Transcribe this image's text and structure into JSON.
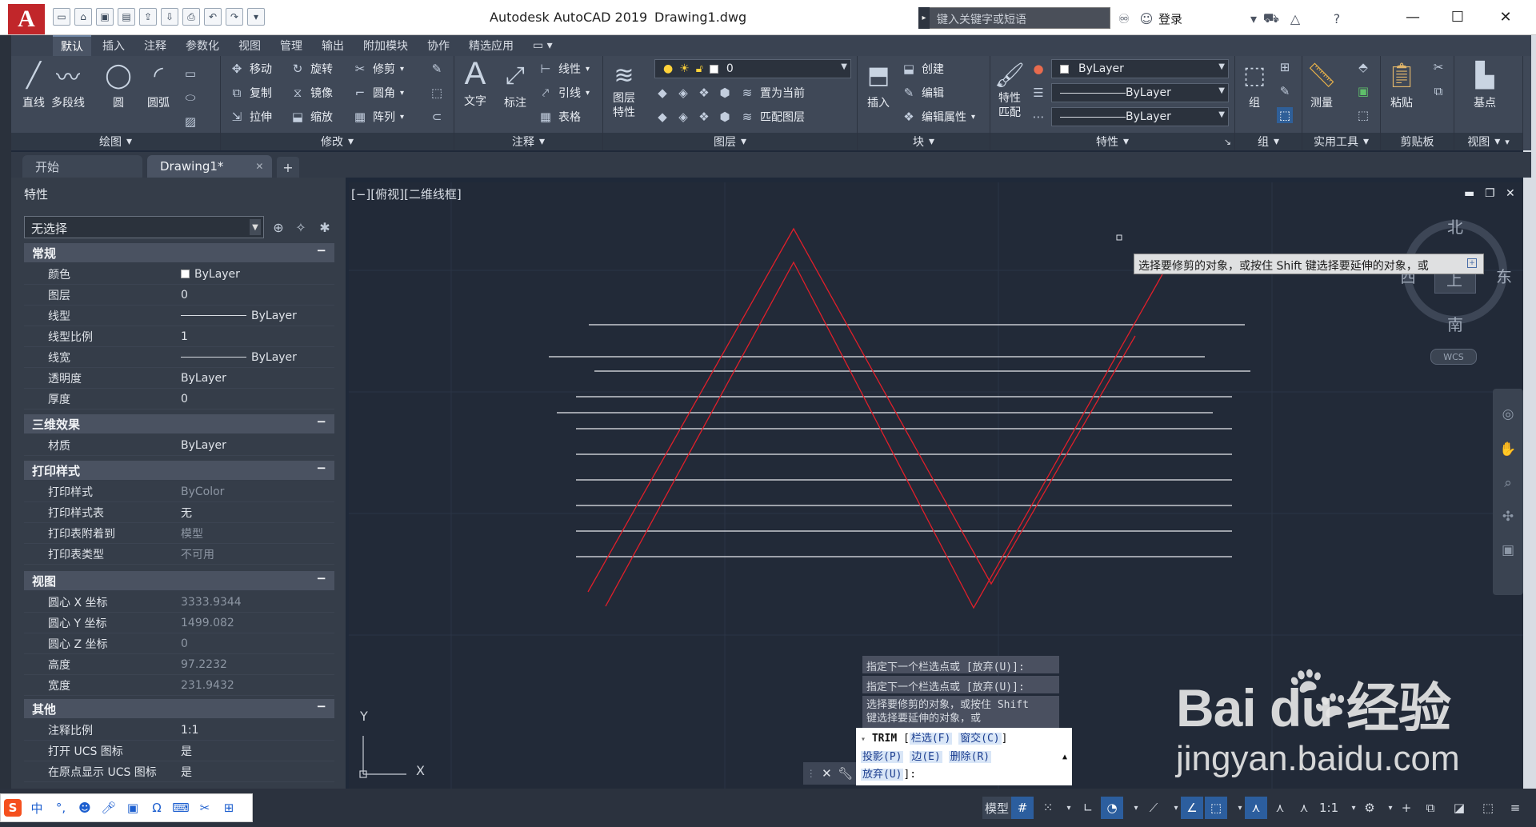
{
  "titlebar": {
    "app_title": "Autodesk AutoCAD 2019",
    "doc_title": "Drawing1.dwg",
    "search_placeholder": "键入关键字或短语",
    "signin_label": "登录",
    "logo_letter": "A"
  },
  "ribbon_tabs": [
    "默认",
    "插入",
    "注释",
    "参数化",
    "视图",
    "管理",
    "输出",
    "附加模块",
    "协作",
    "精选应用"
  ],
  "panels": {
    "draw": {
      "title": "绘图",
      "line": "直线",
      "polyline": "多段线",
      "circle": "圆",
      "arc": "圆弧"
    },
    "modify": {
      "title": "修改",
      "move": "移动",
      "rotate": "旋转",
      "trim": "修剪",
      "copy": "复制",
      "mirror": "镜像",
      "fillet": "圆角",
      "stretch": "拉伸",
      "scale": "缩放",
      "array": "阵列"
    },
    "annotation": {
      "title": "注释",
      "text": "文字",
      "dimension": "标注",
      "linear": "线性",
      "leader": "引线",
      "table": "表格"
    },
    "layers": {
      "title": "图层",
      "layer_props_1": "图层",
      "layer_props_2": "特性",
      "layer_value": "0",
      "set_current": "置为当前",
      "match_layer": "匹配图层"
    },
    "block": {
      "title": "块",
      "insert": "插入",
      "create": "创建",
      "edit": "编辑",
      "edit_attr": "编辑属性"
    },
    "properties": {
      "title": "特性",
      "match_1": "特性",
      "match_2": "匹配",
      "color": "ByLayer",
      "linetype": "ByLayer",
      "lineweight": "ByLayer"
    },
    "groups": {
      "title": "组",
      "group": "组"
    },
    "utilities": {
      "title": "实用工具",
      "measure": "测量"
    },
    "clipboard": {
      "title": "剪贴板",
      "paste": "粘贴"
    },
    "view": {
      "title": "视图",
      "base": "基点"
    }
  },
  "file_tabs": [
    {
      "label": "开始"
    },
    {
      "label": "Drawing1*"
    }
  ],
  "properties_palette": {
    "title": "特性",
    "selection": "无选择",
    "sections": {
      "general": {
        "title": "常规",
        "rows": [
          {
            "k": "颜色",
            "v": "ByLayer"
          },
          {
            "k": "图层",
            "v": "0"
          },
          {
            "k": "线型",
            "v": "ByLayer"
          },
          {
            "k": "线型比例",
            "v": "1"
          },
          {
            "k": "线宽",
            "v": "ByLayer"
          },
          {
            "k": "透明度",
            "v": "ByLayer"
          },
          {
            "k": "厚度",
            "v": "0"
          }
        ]
      },
      "three_d": {
        "title": "三维效果",
        "rows": [
          {
            "k": "材质",
            "v": "ByLayer"
          }
        ]
      },
      "plot": {
        "title": "打印样式",
        "rows": [
          {
            "k": "打印样式",
            "v": "ByColor"
          },
          {
            "k": "打印样式表",
            "v": "无"
          },
          {
            "k": "打印表附着到",
            "v": "模型"
          },
          {
            "k": "打印表类型",
            "v": "不可用"
          }
        ]
      },
      "view": {
        "title": "视图",
        "rows": [
          {
            "k": "圆心 X 坐标",
            "v": "3333.9344"
          },
          {
            "k": "圆心 Y 坐标",
            "v": "1499.082"
          },
          {
            "k": "圆心 Z 坐标",
            "v": "0"
          },
          {
            "k": "高度",
            "v": "97.2232"
          },
          {
            "k": "宽度",
            "v": "231.9432"
          }
        ]
      },
      "misc": {
        "title": "其他",
        "rows": [
          {
            "k": "注释比例",
            "v": "1:1"
          },
          {
            "k": "打开 UCS 图标",
            "v": "是"
          },
          {
            "k": "在原点显示 UCS 图标",
            "v": "是"
          }
        ]
      }
    }
  },
  "viewport": {
    "label": "[−][俯视][二维线框]",
    "tooltip": "选择要修剪的对象，或按住 Shift 键选择要延伸的对象，或",
    "viewcube": {
      "north": "北",
      "south": "南",
      "east": "东",
      "west": "西",
      "top": "上",
      "wcs": "WCS"
    },
    "ucs": {
      "x": "X",
      "y": "Y"
    }
  },
  "command": {
    "history": [
      "指定下一个栏选点或 [放弃(U)]:",
      "指定下一个栏选点或 [放弃(U)]:",
      "选择要修剪的对象，或按住 Shift",
      "键选择要延伸的对象，或"
    ],
    "prompt_cmd": "TRIM",
    "opt_fence": "栏选(F)",
    "opt_crossing": "窗交(C)",
    "opt_project": "投影(P)",
    "opt_edge": "边(E)",
    "opt_erase": "删除(R)",
    "opt_undo": "放弃(U)"
  },
  "status": {
    "model": "模型",
    "scale": "1:1"
  },
  "ime": {
    "lang": "中"
  },
  "watermark": {
    "line1": "Bai du 经验",
    "line2": "jingyan.baidu.com"
  }
}
